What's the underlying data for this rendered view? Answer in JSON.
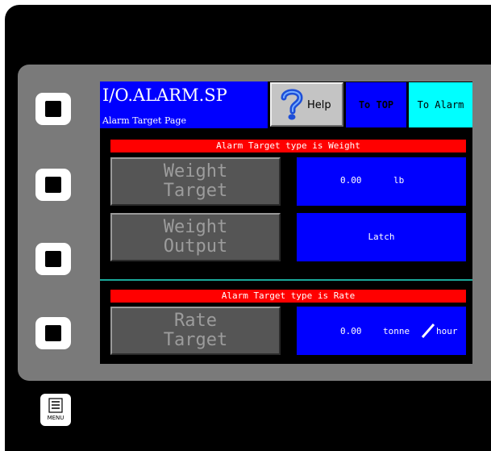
{
  "header": {
    "title": "I/O.ALARM.SP",
    "subtitle": "Alarm Target Page",
    "help_label": "Help",
    "help_icon": "question-mark-icon",
    "to_top_label": "To TOP",
    "to_alarm_label": "To Alarm"
  },
  "weight_section": {
    "banner": "Alarm Target type is Weight",
    "target_button": [
      "Weight",
      "Target"
    ],
    "target_value": "0.00",
    "target_unit": "lb",
    "output_button": [
      "Weight",
      "Output"
    ],
    "output_value": "Latch"
  },
  "rate_section": {
    "banner": "Alarm Target type is Rate",
    "target_button": [
      "Rate",
      "Target"
    ],
    "target_value": "0.00",
    "target_unit_num": "tonne",
    "target_unit_den": "hour"
  },
  "menu": {
    "label": "MENU",
    "icon": "menu-list-icon"
  },
  "colors": {
    "header_blue": "#0000ff",
    "to_alarm_cyan": "#00ffff",
    "banner_red": "#ff0000",
    "button_gray": "#555555",
    "divider_teal": "#1aa89a"
  }
}
